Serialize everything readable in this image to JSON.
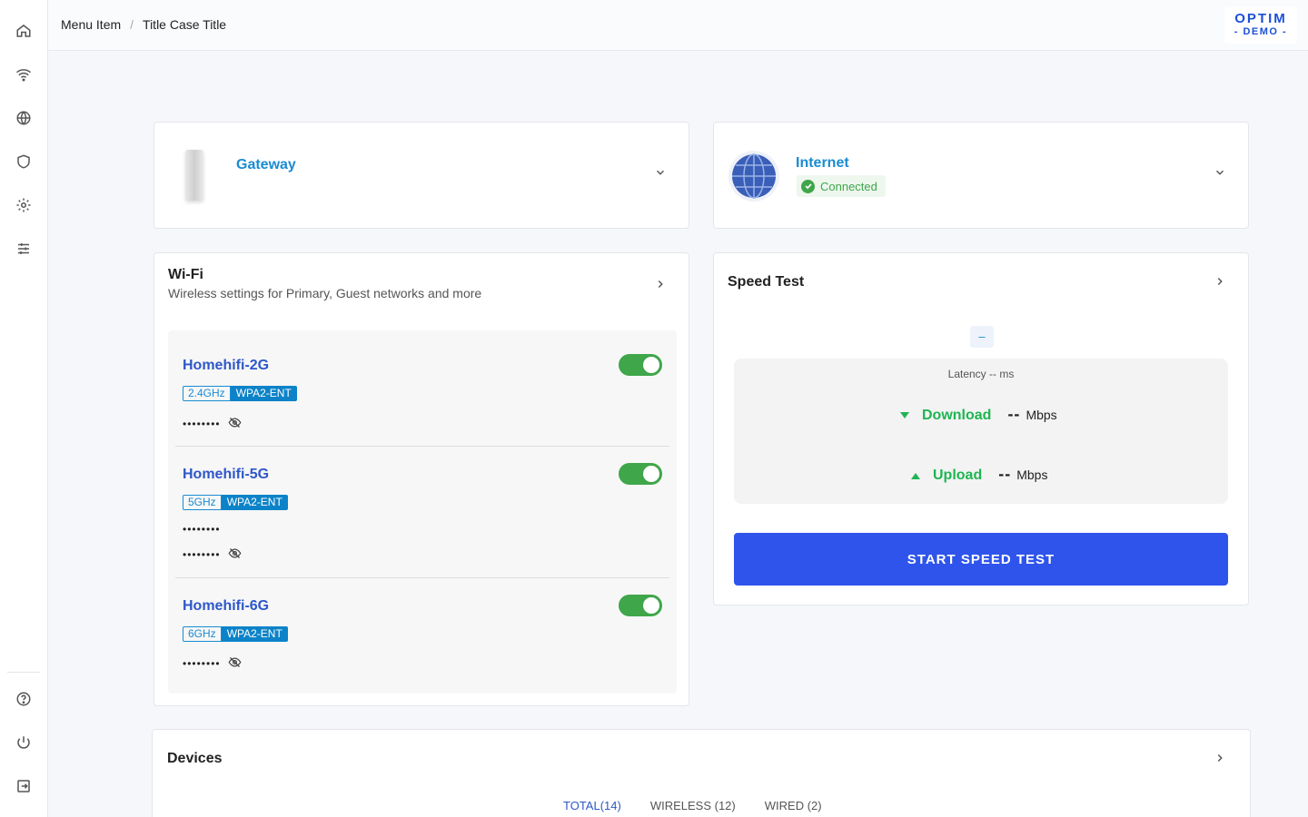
{
  "breadcrumb": {
    "item1": "Menu Item",
    "separator": "/",
    "item2": "Title Case Title"
  },
  "logo": {
    "line1": "OPTIM",
    "line2": "- DEMO -"
  },
  "sidebar": {
    "top_icons": [
      "home-icon",
      "wifi-icon",
      "globe-icon",
      "shield-icon",
      "gear-icon",
      "sliders-icon"
    ],
    "bottom_icons": [
      "help-icon",
      "power-icon",
      "logout-icon"
    ]
  },
  "gateway": {
    "title": "Gateway"
  },
  "internet": {
    "title": "Internet",
    "status": "Connected"
  },
  "wifi": {
    "title": "Wi-Fi",
    "subtitle": "Wireless settings for Primary, Guest networks and more",
    "networks": [
      {
        "name": "Homehifi-2G",
        "band": "2.4GHz",
        "security": "WPA2-ENT",
        "password": "••••••••",
        "enabled": true
      },
      {
        "name": "Homehifi-5G",
        "band": "5GHz",
        "security": "WPA2-ENT",
        "password_extra": "••••••••",
        "password": "••••••••",
        "enabled": true
      },
      {
        "name": "Homehifi-6G",
        "band": "6GHz",
        "security": "WPA2-ENT",
        "password": "••••••••",
        "enabled": true
      }
    ]
  },
  "speed_test": {
    "title": "Speed Test",
    "pill": "–",
    "latency": "Latency -- ms",
    "download_label": "Download",
    "download_value": "--",
    "download_unit": "Mbps",
    "upload_label": "Upload",
    "upload_value": "--",
    "upload_unit": "Mbps",
    "button": "START SPEED TEST"
  },
  "devices": {
    "title": "Devices",
    "tabs": [
      "TOTAL(14)",
      "WIRELESS (12)",
      "WIRED (2)"
    ]
  },
  "colors": {
    "primary": "#2f54eb",
    "link": "#1a8bd2",
    "toggle_on": "#3fa64a",
    "success": "#1fb552"
  }
}
